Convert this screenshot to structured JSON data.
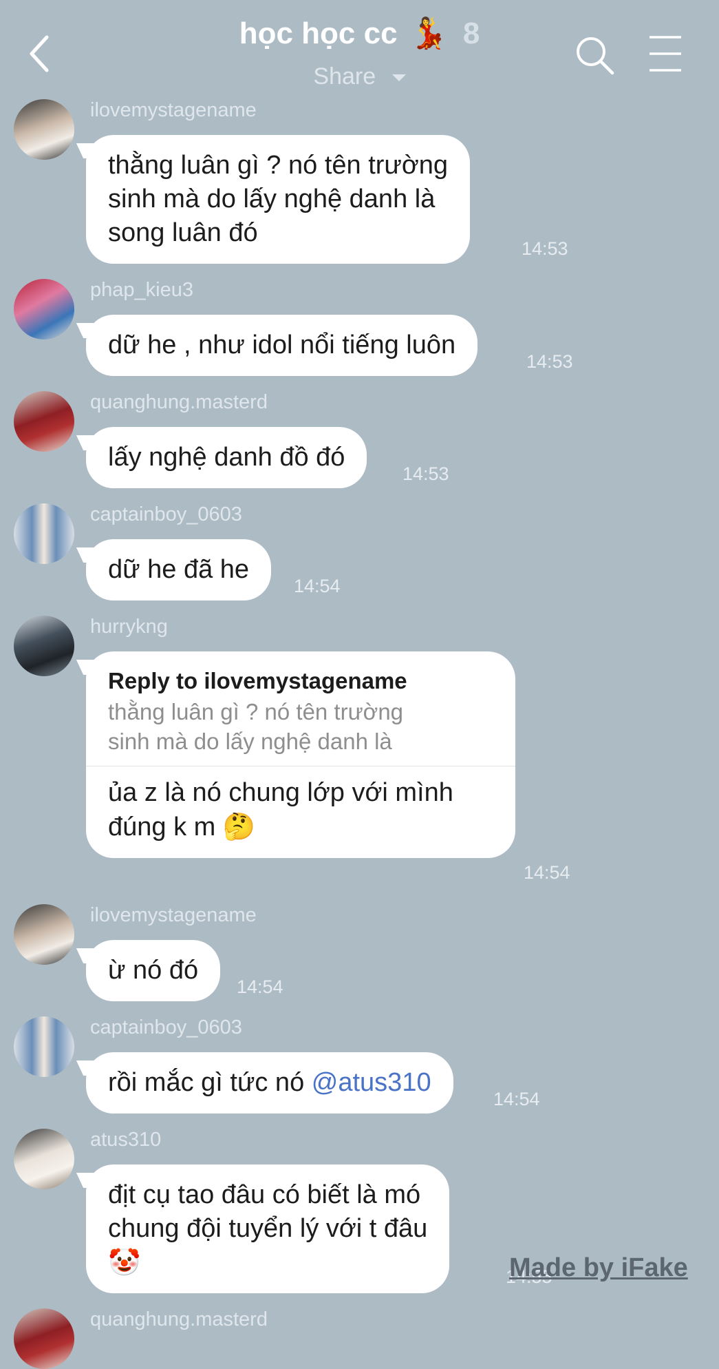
{
  "header": {
    "title": "học học cc",
    "title_emoji": "💃",
    "member_count": "8",
    "share_label": "Share"
  },
  "messages": [
    {
      "user": "ilovemystagename",
      "lines": [
        "thằng luân gì ? nó tên trường",
        "sinh mà do lấy nghệ danh là",
        "song luân đó"
      ],
      "time": "14:53"
    },
    {
      "user": "phap_kieu3",
      "lines": [
        "dữ he , như idol nổi tiếng luôn"
      ],
      "time": "14:53"
    },
    {
      "user": "quanghung.masterd",
      "lines": [
        "lấy nghệ danh đồ đó"
      ],
      "time": "14:53"
    },
    {
      "user": "captainboy_0603",
      "lines": [
        "dữ he đã he"
      ],
      "time": "14:54"
    },
    {
      "user": "hurrykng",
      "reply_title": "Reply to ilovemystagename",
      "reply_lines": [
        "thằng luân gì ? nó tên trường",
        "sinh mà do lấy nghệ danh là"
      ],
      "lines": [
        "ủa z là nó chung lớp với mình",
        "đúng k m"
      ],
      "emoji": "🤔",
      "time": "14:54"
    },
    {
      "user": "ilovemystagename",
      "lines": [
        "ừ nó đó"
      ],
      "time": "14:54"
    },
    {
      "user": "captainboy_0603",
      "text": "rồi mắc gì tức nó",
      "mention": "@atus310",
      "time": "14:54"
    },
    {
      "user": "atus310",
      "lines": [
        "địt cụ tao đâu có biết là mó",
        "chung đội tuyển lý với t đâu"
      ],
      "emoji": "🤡",
      "time": "14:55"
    },
    {
      "user": "quanghung.masterd"
    }
  ],
  "watermark": "Made by iFake",
  "colors": {
    "background": "#adbbc5",
    "bubble": "#ffffff",
    "mention": "#4a72c6"
  }
}
